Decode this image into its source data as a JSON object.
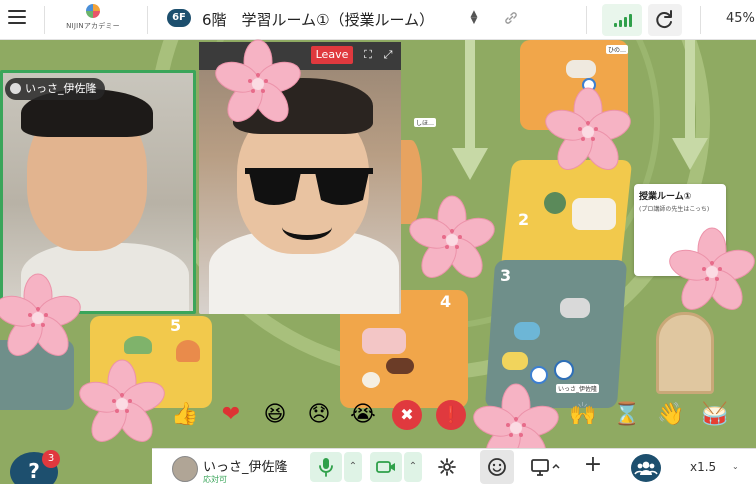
{
  "topbar": {
    "logo_text": "NIJINアカデミー",
    "floor_badge": "6F",
    "room_title": "6階　学習ルーム①（授業ルーム）",
    "zoom_percent": "45%"
  },
  "map": {
    "zones": [
      {
        "label": "2"
      },
      {
        "label": "3"
      },
      {
        "label": "4"
      },
      {
        "label": "5"
      }
    ],
    "note": {
      "title": "授業ルーム①",
      "subtitle": "(プロ講師の先生はこっち)"
    },
    "avatar_label": "いっさ_伊佐隆",
    "small_label_a": "しほ…",
    "small_label_b": "ひの…"
  },
  "video": {
    "participant_1_name": "いっさ_伊佐隆",
    "leave_label": "Leave"
  },
  "reactions": [
    {
      "name": "thumbs-up",
      "glyph": "👍"
    },
    {
      "name": "heart",
      "glyph": "❤"
    },
    {
      "name": "laughing",
      "glyph": "😆"
    },
    {
      "name": "sad",
      "glyph": "😞"
    },
    {
      "name": "crying",
      "glyph": "😭"
    },
    {
      "name": "cross",
      "glyph": "✖"
    },
    {
      "name": "exclamation",
      "glyph": "❗"
    },
    {
      "name": "raising-hands",
      "glyph": "🙌"
    },
    {
      "name": "hourglass",
      "glyph": "⌛"
    },
    {
      "name": "waving-hand",
      "glyph": "👋"
    },
    {
      "name": "drum",
      "glyph": "🥁"
    }
  ],
  "bottombar": {
    "help_badge": "3",
    "user_name": "いっさ_伊佐隆",
    "user_status": "応対可",
    "scale": "x1.5"
  },
  "colors": {
    "accent": "#1d4f6e",
    "leave": "#e0393e",
    "active_green": "#3aa55a",
    "sakura": "#f7b6c6"
  }
}
